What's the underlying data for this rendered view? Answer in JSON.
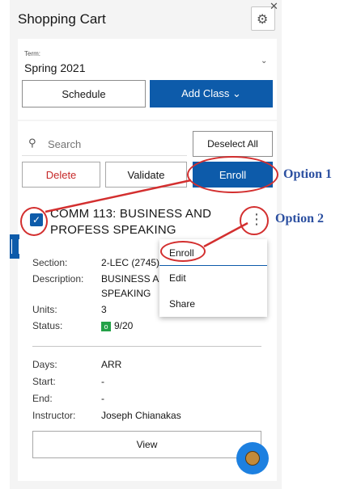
{
  "header": {
    "title": "Shopping Cart",
    "settings_icon": "gear-icon",
    "close_icon": "close-icon"
  },
  "term": {
    "label": "Term:",
    "value": "Spring 2021"
  },
  "actions": {
    "schedule": "Schedule",
    "add_class": "Add Class ⌄"
  },
  "search": {
    "placeholder": "Search"
  },
  "toolbar": {
    "deselect_all": "Deselect All",
    "delete": "Delete",
    "validate": "Validate",
    "enroll": "Enroll"
  },
  "annotations": {
    "option1": "Option 1",
    "option2": "Option 2"
  },
  "course": {
    "title": "COMM 113: BUSINESS AND PROFESS SPEAKING",
    "checked": true,
    "section_label": "Section:",
    "section_value": "2-LEC (2745)",
    "description_label": "Description:",
    "description_value_1": "BUSINESS AN",
    "description_value_2": "SPEAKING",
    "units_label": "Units:",
    "units_value": "3",
    "status_label": "Status:",
    "status_badge": "o",
    "status_value": "9/20",
    "days_label": "Days:",
    "days_value": "ARR",
    "start_label": "Start:",
    "start_value": "-",
    "end_label": "End:",
    "end_value": "-",
    "instructor_label": "Instructor:",
    "instructor_value": "Joseph Chianakas"
  },
  "menu": {
    "items": [
      {
        "label": "Enroll"
      },
      {
        "label": "Edit"
      },
      {
        "label": "Share"
      }
    ]
  },
  "view_button": "View",
  "colors": {
    "primary": "#0d5baa",
    "annotation_red": "#d32f2f",
    "annotation_blue": "#2b4fa0",
    "status_green": "#24a148"
  }
}
